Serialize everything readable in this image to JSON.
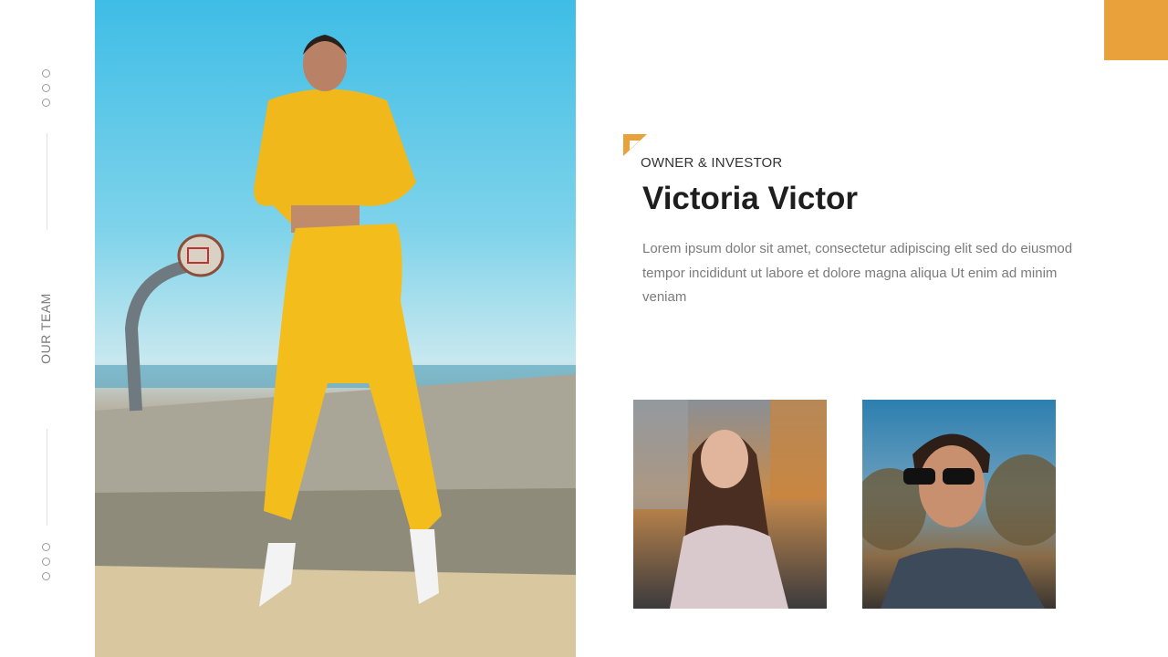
{
  "rail": {
    "label": "OUR TEAM"
  },
  "profile": {
    "role": "OWNER & INVESTOR",
    "name": "Victoria Victor",
    "description": "Lorem ipsum dolor sit amet, consectetur adipiscing elit sed do eiusmod tempor incididunt ut labore et dolore magna aliqua Ut enim ad minim veniam"
  },
  "colors": {
    "accent": "#e9a13b",
    "text_dark": "#1e1e1e",
    "text_muted": "#7b7b7b"
  }
}
